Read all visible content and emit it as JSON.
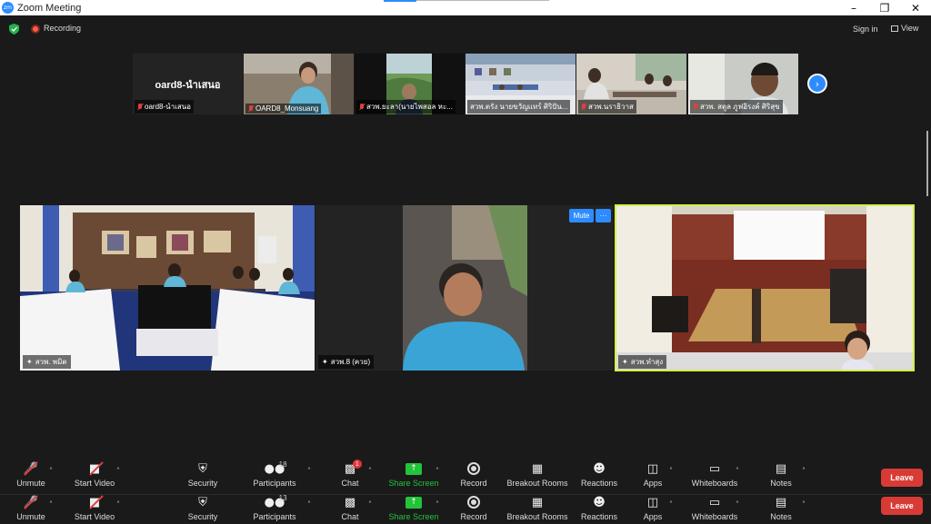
{
  "window": {
    "title": "Zoom Meeting",
    "app_icon": "zm"
  },
  "topbar": {
    "recording_label": "Recording",
    "sign_in": "Sign in",
    "view": "View"
  },
  "gallery_strip": [
    {
      "label": "oard8-นำเสนอ",
      "name": "oard8-นำเสนอ",
      "muted": true
    },
    {
      "name": "OARD8_Monsuang",
      "muted": true
    },
    {
      "name": "สวพ.ยะลา(นายไพสอล หะ...",
      "muted": true
    },
    {
      "name": "สวพ.ตรัง นายขวัญแทร์ ศิริปัน...",
      "muted": false
    },
    {
      "name": "สวพ.นราธิวาส",
      "muted": true
    },
    {
      "name": "สวพ. สตูล ภูฟอิรงค์ ศิริสุข",
      "muted": true
    }
  ],
  "main_tiles": [
    {
      "name": "สวพ. พมิต"
    },
    {
      "name": "สวพ.8 (ควย)"
    },
    {
      "name": "สวพ.ทำสุง",
      "active_speaker": true
    }
  ],
  "tile_controls": {
    "mute": "Mute",
    "more": "···"
  },
  "toolbar": {
    "unmute": "Unmute",
    "start_video": "Start Video",
    "security": "Security",
    "participants": "Participants",
    "participants_count": "18",
    "chat": "Chat",
    "chat_badge": "1",
    "share_screen": "Share Screen",
    "record": "Record",
    "breakout_rooms": "Breakout Rooms",
    "reactions": "Reactions",
    "apps": "Apps",
    "whiteboards": "Whiteboards",
    "notes": "Notes",
    "leave": "Leave"
  },
  "toolbar_ghost": {
    "participants_count": "13"
  },
  "colors": {
    "accent_blue": "#2d8cff",
    "leave_red": "#d83b36",
    "share_green": "#21c43a",
    "active_speaker_border": "#d4f04a"
  }
}
